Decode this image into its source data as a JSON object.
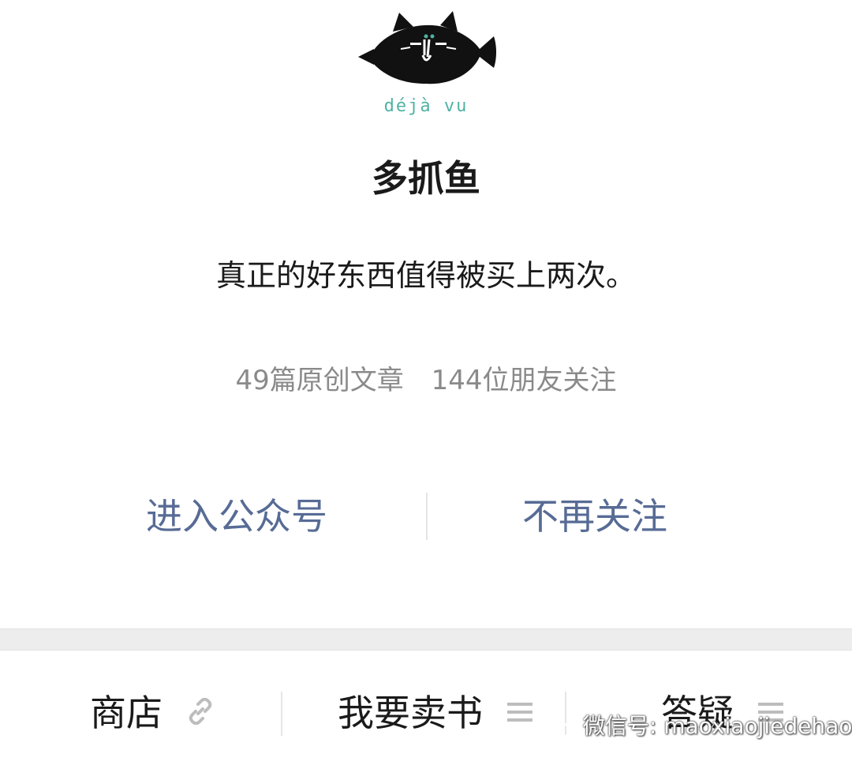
{
  "logo": {
    "text": "déjà vu"
  },
  "account": {
    "name": "多抓鱼",
    "description": "真正的好东西值得被买上两次。",
    "stats": {
      "articles": "49篇原创文章",
      "followers": "144位朋友关注"
    }
  },
  "actions": {
    "enter_label": "进入公众号",
    "unfollow_label": "不再关注"
  },
  "menu": {
    "items": [
      {
        "label": "商店",
        "icon": "link-icon"
      },
      {
        "label": "我要卖书",
        "icon": "menu-lines-icon"
      },
      {
        "label": "答疑",
        "icon": "menu-lines-icon"
      }
    ]
  },
  "watermark": {
    "text": "微信号: maoxiaojiedehao"
  },
  "colors": {
    "link_blue": "#576b95",
    "logo_teal": "#4fb3a3",
    "text_dark": "#1a1a1a",
    "text_gray": "#8a8a8a"
  }
}
